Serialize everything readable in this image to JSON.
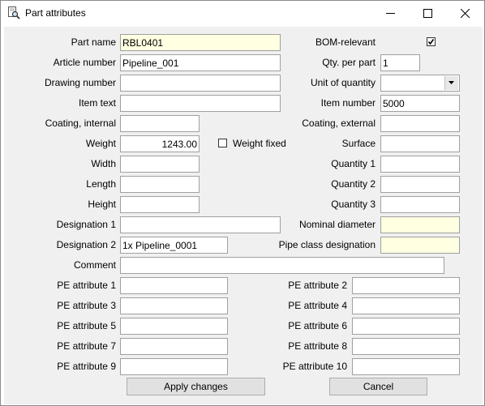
{
  "window": {
    "title": "Part attributes"
  },
  "left": {
    "part_name": {
      "label": "Part name",
      "value": "RBL0401"
    },
    "article_number": {
      "label": "Article number",
      "value": "Pipeline_001"
    },
    "drawing_number": {
      "label": "Drawing number",
      "value": ""
    },
    "item_text": {
      "label": "Item text",
      "value": ""
    },
    "coating_internal": {
      "label": "Coating, internal",
      "value": ""
    },
    "weight": {
      "label": "Weight",
      "value": "1243.00"
    },
    "width": {
      "label": "Width",
      "value": ""
    },
    "length": {
      "label": "Length",
      "value": ""
    },
    "height": {
      "label": "Height",
      "value": ""
    },
    "designation_1": {
      "label": "Designation 1",
      "value": ""
    },
    "designation_2": {
      "label": "Designation 2",
      "value": "1x Pipeline_0001"
    },
    "comment": {
      "label": "Comment",
      "value": ""
    }
  },
  "right": {
    "bom_relevant": {
      "label": "BOM-relevant",
      "checked": true
    },
    "qty_per_part": {
      "label": "Qty. per part",
      "value": "1"
    },
    "unit_of_quantity": {
      "label": "Unit of quantity",
      "value": ""
    },
    "item_number": {
      "label": "Item number",
      "value": "5000"
    },
    "coating_external": {
      "label": "Coating, external",
      "value": ""
    },
    "surface": {
      "label": "Surface",
      "value": ""
    },
    "quantity_1": {
      "label": "Quantity 1",
      "value": ""
    },
    "quantity_2": {
      "label": "Quantity 2",
      "value": ""
    },
    "quantity_3": {
      "label": "Quantity 3",
      "value": ""
    },
    "nominal_diameter": {
      "label": "Nominal diameter",
      "value": ""
    },
    "pipe_class_designation": {
      "label": "Pipe class designation",
      "value": ""
    }
  },
  "weight_fixed": {
    "label": "Weight fixed",
    "checked": false
  },
  "pe_attributes": [
    {
      "label": "PE attribute 1",
      "value": ""
    },
    {
      "label": "PE attribute 2",
      "value": ""
    },
    {
      "label": "PE attribute 3",
      "value": ""
    },
    {
      "label": "PE attribute 4",
      "value": ""
    },
    {
      "label": "PE attribute 5",
      "value": ""
    },
    {
      "label": "PE attribute 6",
      "value": ""
    },
    {
      "label": "PE attribute 7",
      "value": ""
    },
    {
      "label": "PE attribute 8",
      "value": ""
    },
    {
      "label": "PE attribute 9",
      "value": ""
    },
    {
      "label": "PE attribute 10",
      "value": ""
    }
  ],
  "buttons": {
    "apply": "Apply changes",
    "cancel": "Cancel"
  },
  "colors": {
    "required_field": "#ffffe1",
    "client_background": "#f0f0f0"
  },
  "icons": {
    "app": "document-magnifier-icon",
    "minimize": "minimize-icon",
    "maximize": "maximize-icon",
    "close": "close-icon",
    "dropdown": "chevron-down-icon",
    "check": "checkmark-icon"
  }
}
